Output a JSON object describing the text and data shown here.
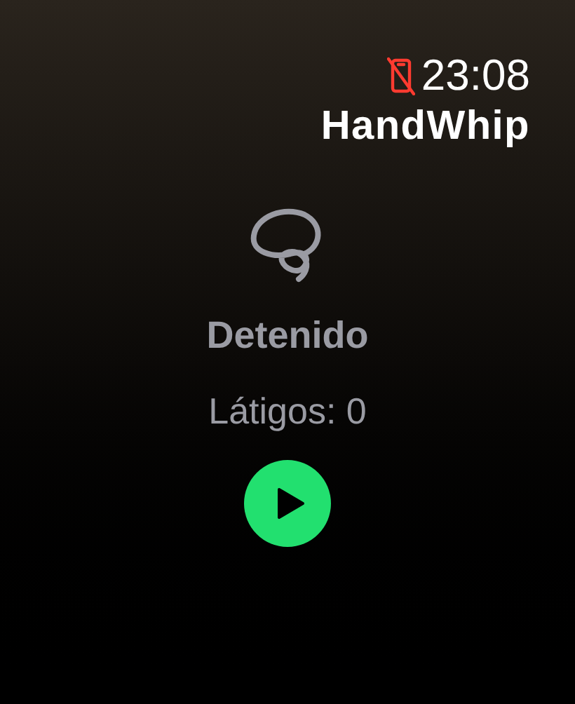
{
  "status_bar": {
    "phone_disconnected": true,
    "time": "23:08"
  },
  "app_title": "HandWhip",
  "status": "Detenido",
  "count": "Látigos: 0",
  "control_button": {
    "kind": "play"
  }
}
